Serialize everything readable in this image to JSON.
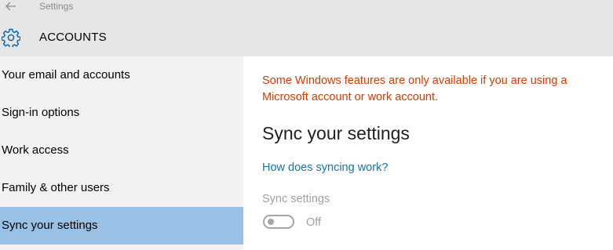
{
  "window": {
    "title": "Settings",
    "back_icon": "back-arrow-icon"
  },
  "header": {
    "icon": "gear-icon",
    "title": "ACCOUNTS"
  },
  "sidebar": {
    "items": [
      {
        "label": "Your email and accounts"
      },
      {
        "label": "Sign-in options"
      },
      {
        "label": "Work access"
      },
      {
        "label": "Family & other users"
      },
      {
        "label": "Sync your settings",
        "selected": true
      }
    ]
  },
  "main": {
    "warning": "Some Windows features are only available if you are using a Microsoft account or work account.",
    "title": "Sync your settings",
    "help_link": "How does syncing work?",
    "sync_settings": {
      "label": "Sync settings",
      "state": "Off"
    }
  },
  "colors": {
    "header_bg": "#e6e6e6",
    "sidebar_bg": "#f2f2f2",
    "selected_bg": "#99c1e6",
    "warning": "#d83b01",
    "link": "#1a73a8",
    "accent_icon": "#0063b1"
  }
}
